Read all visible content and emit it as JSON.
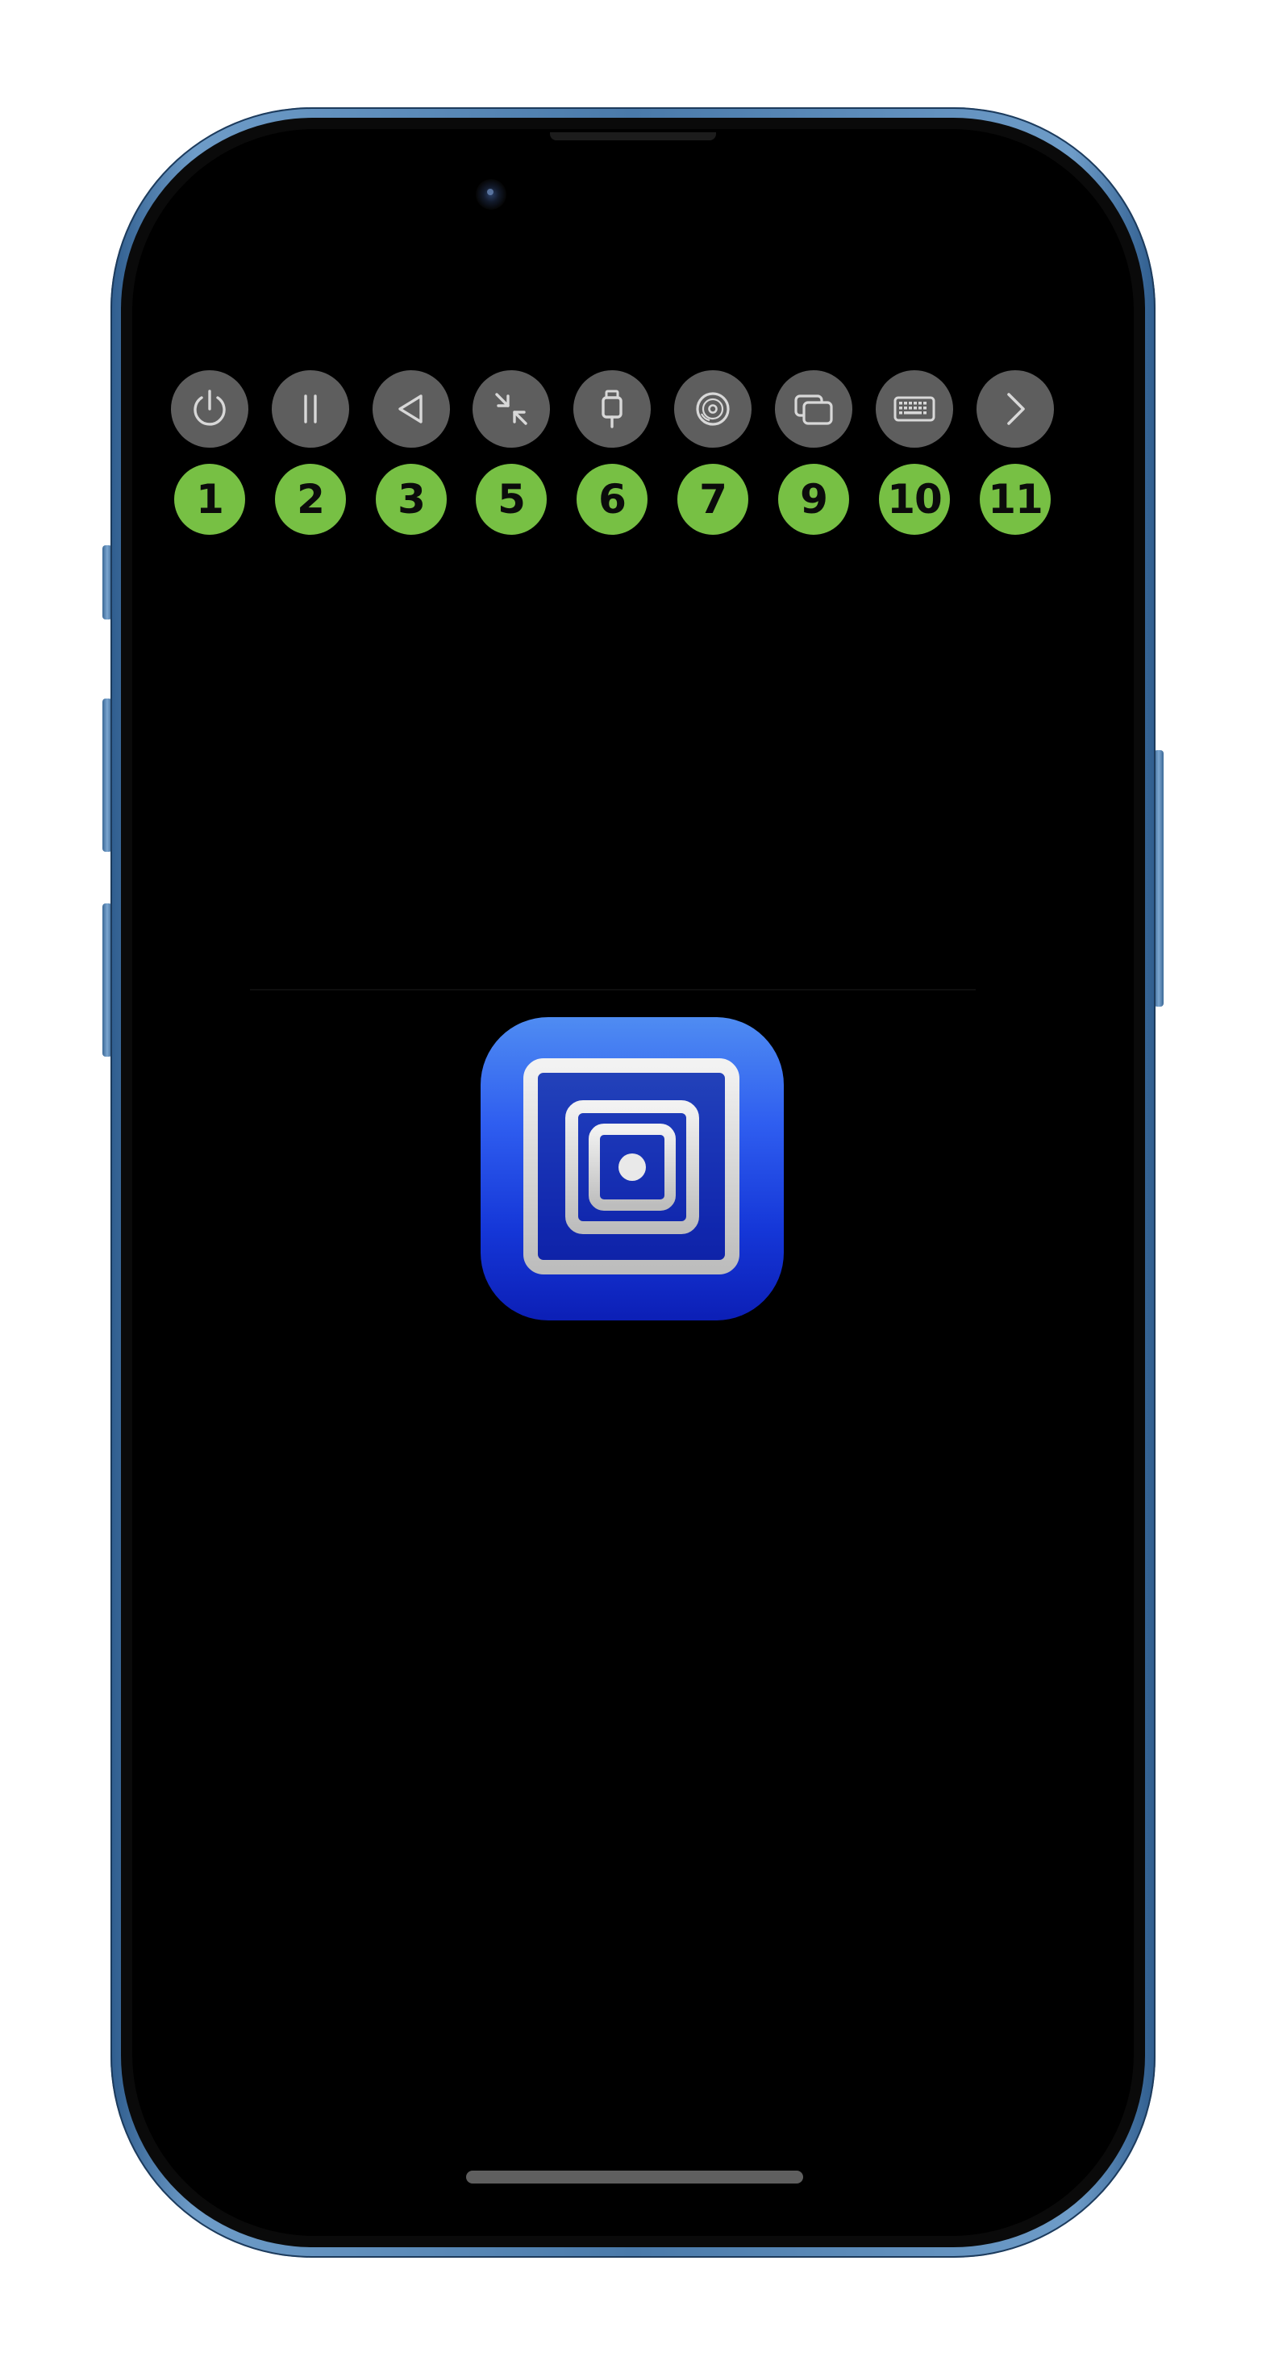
{
  "device": {
    "frame_color": "#4a7aaa",
    "screen_color": "#000000"
  },
  "toolbar": {
    "button_color": "#5e5e5e",
    "icon_color": "#d8d8d8",
    "badge_color": "#77c044",
    "items": [
      {
        "icon": "power-icon",
        "badge": "1"
      },
      {
        "icon": "pause-icon",
        "badge": "2"
      },
      {
        "icon": "back-triangle-icon",
        "badge": "3"
      },
      {
        "icon": "minimize-arrows-icon",
        "badge": "5"
      },
      {
        "icon": "usb-plug-icon",
        "badge": "6"
      },
      {
        "icon": "disc-icon",
        "badge": "7"
      },
      {
        "icon": "windows-icon",
        "badge": "9"
      },
      {
        "icon": "keyboard-icon",
        "badge": "10"
      },
      {
        "icon": "chevron-right-icon",
        "badge": "11"
      }
    ]
  },
  "center": {
    "logo_icon": "utm-app-logo-icon",
    "logo_gradient_top": "#4f8cf2",
    "logo_gradient_bottom": "#0c1fb6"
  }
}
